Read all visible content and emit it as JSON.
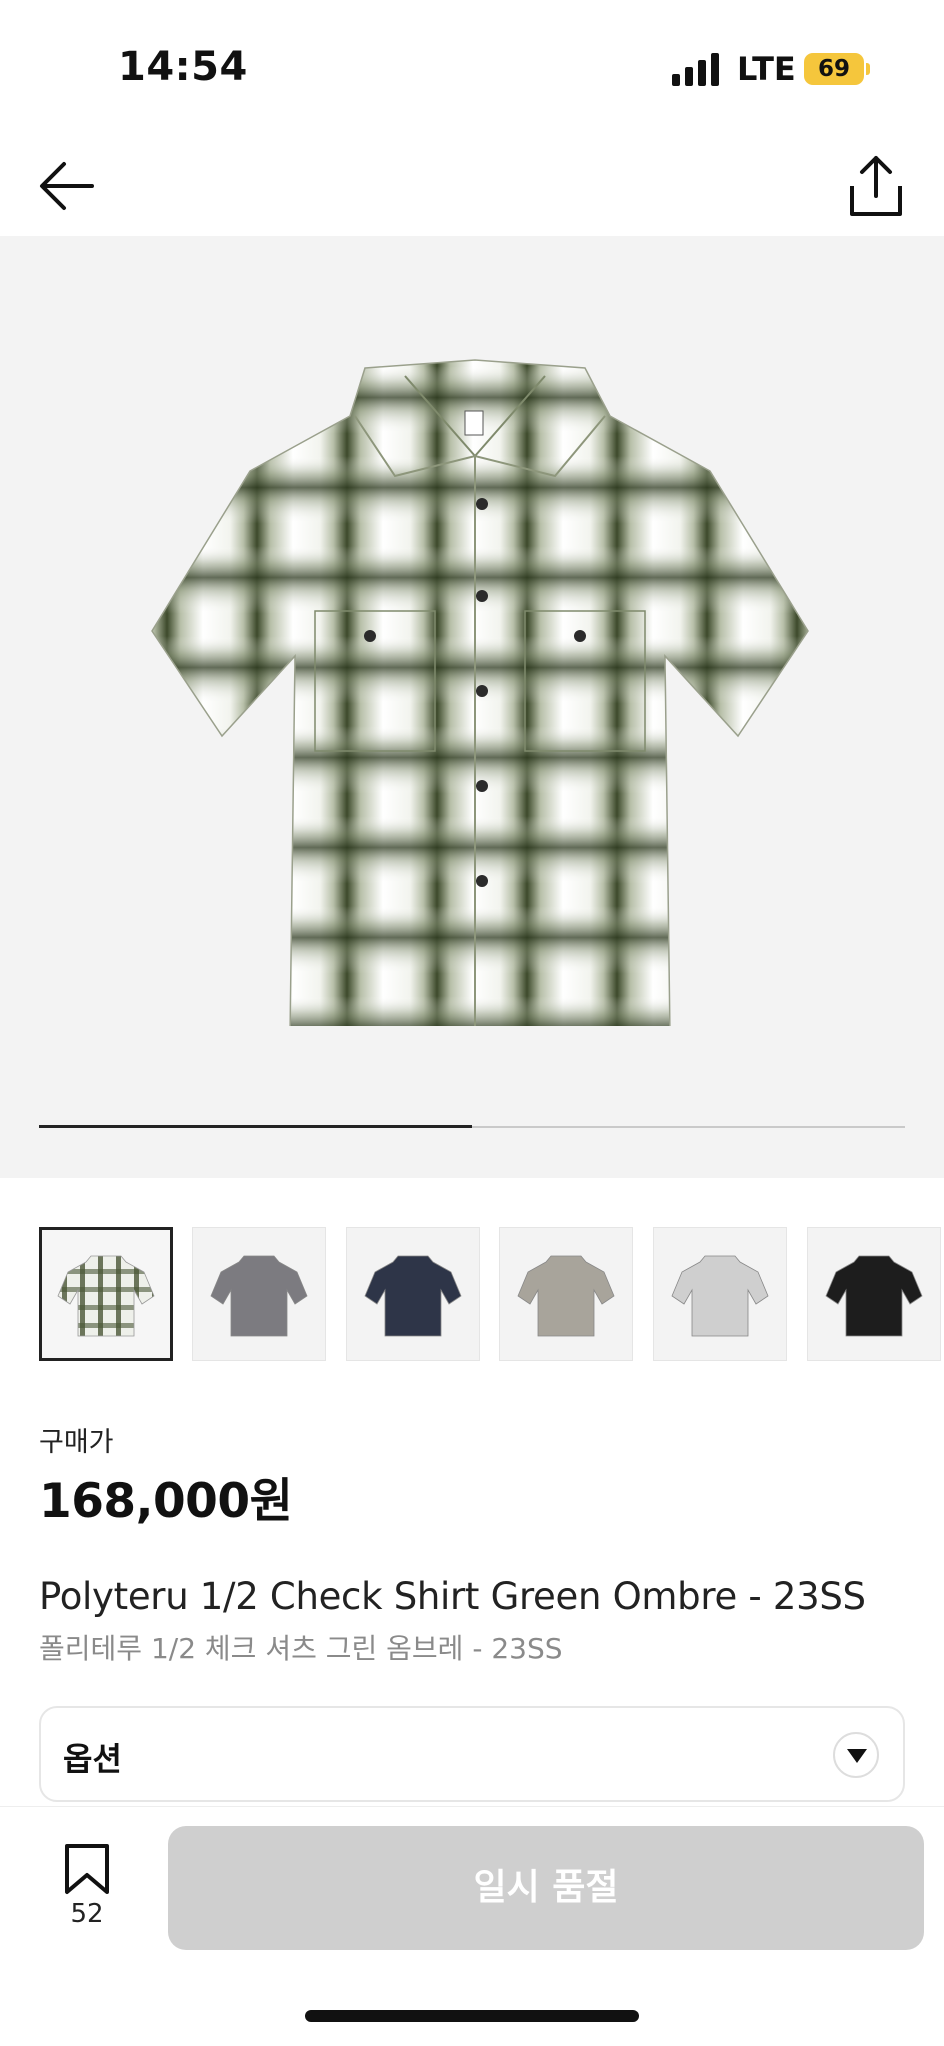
{
  "status_bar": {
    "time": "14:54",
    "network": "LTE",
    "battery": "69",
    "battery_color": "#f5c63c"
  },
  "nav": {
    "back_icon": "arrow-left-icon",
    "share_icon": "share-icon"
  },
  "gallery": {
    "page_progress": 0.5,
    "background": "#f3f3f3"
  },
  "thumbnails": [
    {
      "color": "plaid-green",
      "selected": true
    },
    {
      "color": "#7c7b80",
      "selected": false
    },
    {
      "color": "#2e3548",
      "selected": false
    },
    {
      "color": "#a8a49b",
      "selected": false
    },
    {
      "color": "#cfcfcf",
      "selected": false
    },
    {
      "color": "#1d1d1d",
      "selected": false
    }
  ],
  "product": {
    "price_label": "구매가",
    "price": "168,000원",
    "name_en": "Polyteru 1/2 Check Shirt Green Ombre - 23SS",
    "name_ko": "폴리테루 1/2 체크 셔츠 그린 옴브레 - 23SS"
  },
  "option": {
    "label": "옵션"
  },
  "bottom_bar": {
    "bookmark_count": "52",
    "buy_button_label": "일시 품절"
  }
}
